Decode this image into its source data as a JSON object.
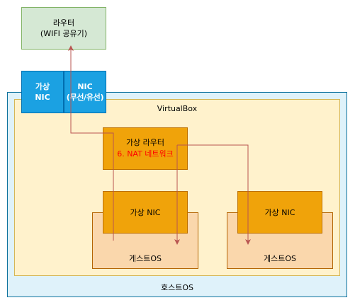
{
  "router": {
    "line1": "라우터",
    "line2": "(WIFI 공유기)"
  },
  "virtual_nic": {
    "line1": "가상",
    "line2": "NIC"
  },
  "physical_nic": {
    "line1": "NIC",
    "line2": "(무선/유선)"
  },
  "host_os_label": "호스트OS",
  "virtualbox_label": "VirtualBox",
  "virtual_router": {
    "line1": "가상 라우터",
    "line2": "6. NAT 네트워크"
  },
  "guest_left": {
    "nic_label": "가상 NIC",
    "os_label": "게스트OS"
  },
  "guest_right": {
    "nic_label": "가상 NIC",
    "os_label": "게스트OS"
  },
  "colors": {
    "router_fill": "#d5e8d4",
    "router_stroke": "#82b366",
    "nic_fill": "#1ba1e2",
    "nic_stroke": "#006eaf",
    "host_fill": "#dff2fa",
    "host_stroke": "#10739e",
    "vbox_fill": "#fff2cc",
    "vbox_stroke": "#d6b656",
    "orange_fill": "#f0a30a",
    "orange_stroke": "#bd7000",
    "guest_fill": "#fad7ac",
    "guest_stroke": "#b46504",
    "arrow": "#b85450",
    "nat_text": "#ff0000"
  }
}
